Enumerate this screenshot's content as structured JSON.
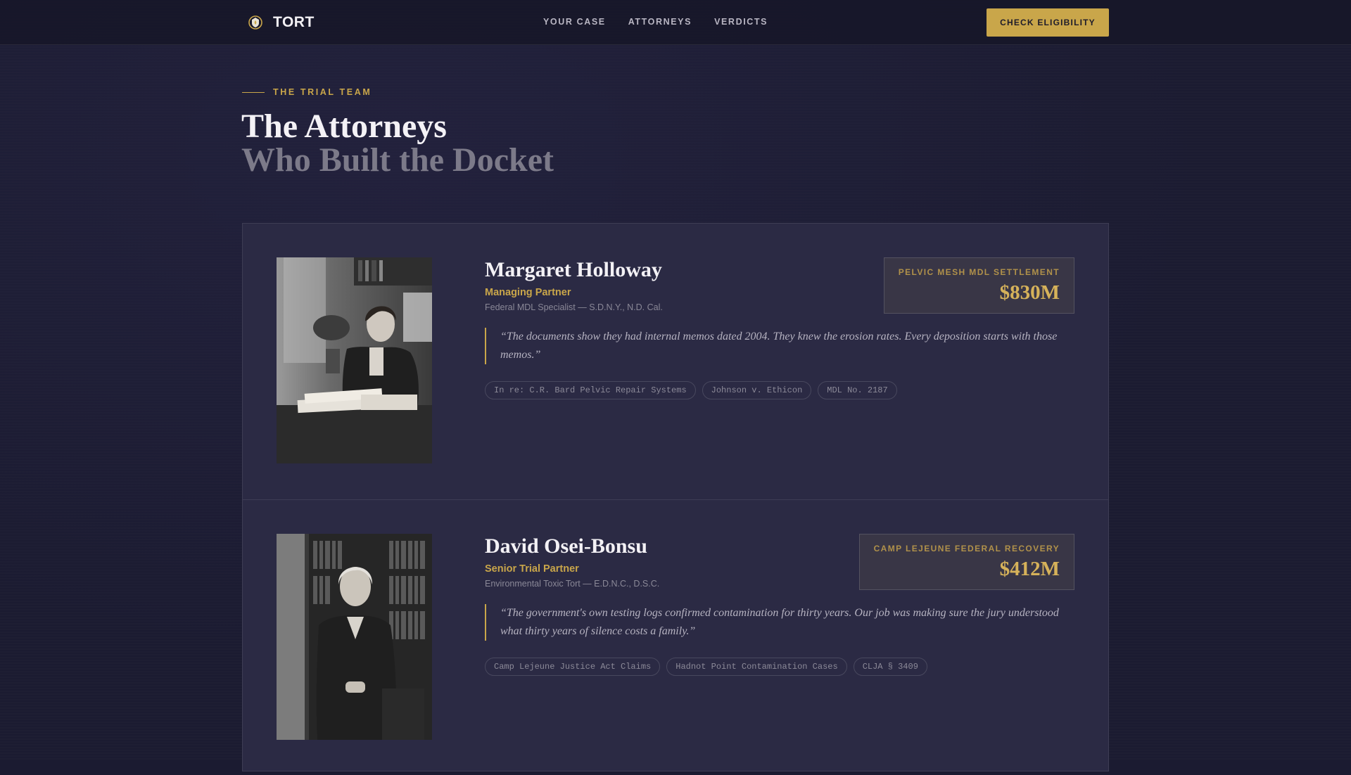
{
  "brand": {
    "name": "TORT",
    "icon": "shield-flame-icon"
  },
  "nav": {
    "links": [
      "YOUR CASE",
      "ATTORNEYS",
      "VERDICTS"
    ],
    "cta": "CHECK ELIGIBILITY"
  },
  "header": {
    "eyebrow": "THE TRIAL TEAM",
    "title_line1": "The Attorneys",
    "title_line2": "Who Built the Docket"
  },
  "attorneys": [
    {
      "name": "Margaret Holloway",
      "role": "Managing Partner",
      "jurisdiction": "Federal MDL Specialist — S.D.N.Y., N.D. Cal.",
      "quote": "“The documents show they had internal memos dated 2004. They knew the erosion rates. Every deposition starts with those memos.”",
      "tags": [
        "In re: C.R. Bard Pelvic Repair Systems",
        "Johnson v. Ethicon",
        "MDL No. 2187"
      ],
      "badge_label": "PELVIC MESH MDL SETTLEMENT",
      "badge_value": "$830M",
      "photo": "attorney-portrait-desk"
    },
    {
      "name": "David Osei-Bonsu",
      "role": "Senior Trial Partner",
      "jurisdiction": "Environmental Toxic Tort — E.D.N.C., D.S.C.",
      "quote": "“The government's own testing logs confirmed contamination for thirty years. Our job was making sure the jury understood what thirty years of silence costs a family.”",
      "tags": [
        "Camp Lejeune Justice Act Claims",
        "Hadnot Point Contamination Cases",
        "CLJA § 3409"
      ],
      "badge_label": "CAMP LEJEUNE FEDERAL RECOVERY",
      "badge_value": "$412M",
      "photo": "attorney-portrait-library"
    }
  ],
  "colors": {
    "accent": "#c9a64a",
    "background": "#1b1b31",
    "card": "#2b2a44"
  }
}
